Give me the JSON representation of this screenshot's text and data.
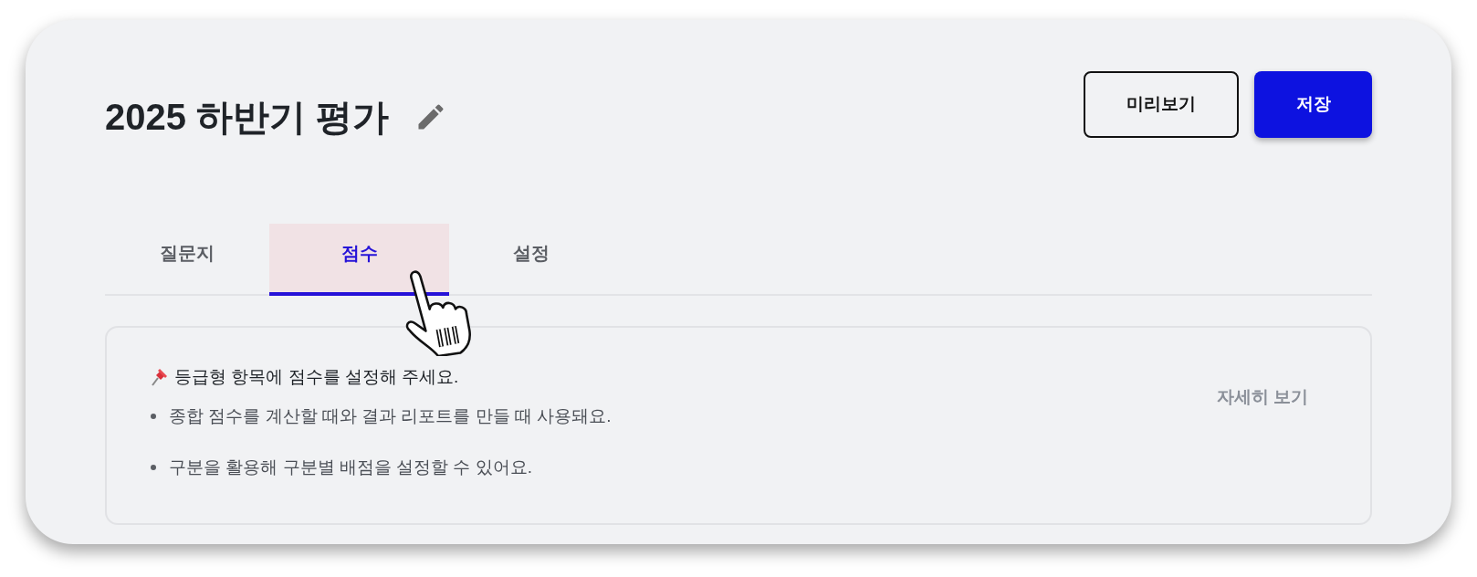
{
  "header": {
    "title": "2025 하반기 평가",
    "buttons": [
      {
        "label": "미리보기",
        "kind": "outline"
      },
      {
        "label": "저장",
        "kind": "primary"
      }
    ]
  },
  "tabs": [
    {
      "label": "질문지",
      "selected": false
    },
    {
      "label": "점수",
      "selected": true
    },
    {
      "label": "설정",
      "selected": false
    }
  ],
  "notice": {
    "heading": "등급형 항목에 점수를 설정해 주세요.",
    "bullets": [
      "종합 점수를 계산할 때와 결과 리포트를 만들 때 사용돼요.",
      "구분을 활용해 구분별 배점을 설정할 수 있어요."
    ],
    "link": "자세히 보기"
  }
}
